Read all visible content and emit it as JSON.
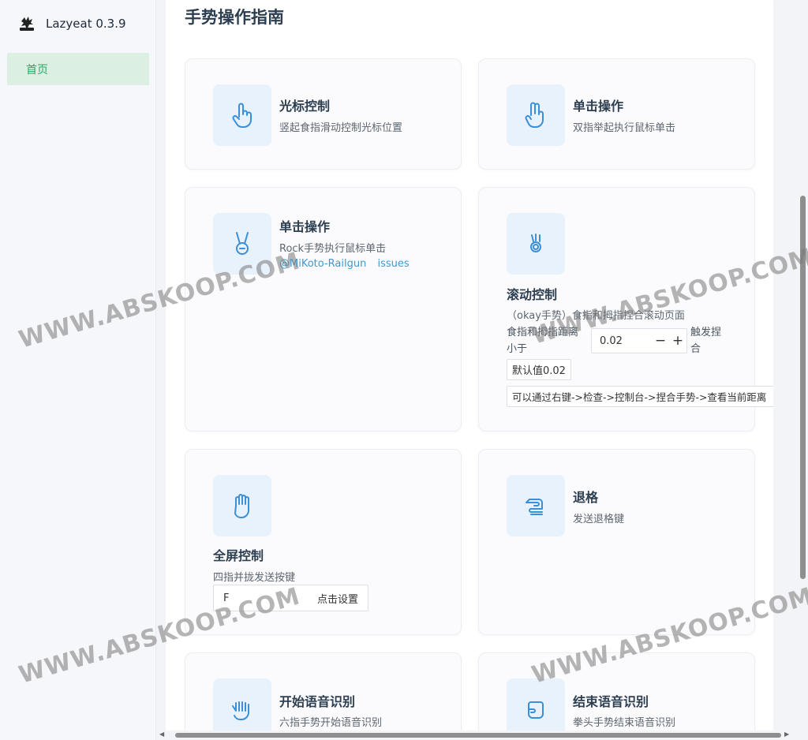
{
  "app": {
    "name": "Lazyeat 0.3.9"
  },
  "sidebar": {
    "items": [
      {
        "label": "首页"
      }
    ]
  },
  "page": {
    "title": "手势操作指南"
  },
  "cards": {
    "cursor": {
      "title": "光标控制",
      "desc": "竖起食指滑动控制光标位置",
      "icon": "pointing-hand-icon"
    },
    "click": {
      "title": "单击操作",
      "desc": "双指举起执行鼠标单击",
      "icon": "two-finger-hand-icon"
    },
    "rock": {
      "title": "单击操作",
      "desc": "Rock手势执行鼠标单击",
      "link_author": "@MiKoto-Railgun",
      "link_issues": "issues",
      "icon": "rock-hand-icon"
    },
    "scroll": {
      "title": "滚动控制",
      "desc": "（okay手势）食指和拇指捏合滚动页面",
      "distance_label_1": "食指和拇指距离",
      "distance_label_2": "小于",
      "threshold_value": "0.02",
      "minus": "−",
      "plus": "+",
      "trigger_label_1": "触发捏",
      "trigger_label_2": "合",
      "default_hint": "默认值0.02",
      "console_hint": "可以通过右键->检查->控制台->捏合手势->查看当前距离",
      "icon": "okay-hand-icon"
    },
    "fullscreen": {
      "title": "全屏控制",
      "desc": "四指并拢发送按键",
      "key_value": "F",
      "set_label": "点击设置",
      "icon": "open-palm-icon"
    },
    "backspace": {
      "title": "退格",
      "desc": "发送退格键",
      "icon": "backspace-hand-icon"
    },
    "voice_start": {
      "title": "开始语音识别",
      "desc": "六指手势开始语音识别",
      "icon": "six-finger-hand-icon"
    },
    "voice_end": {
      "title": "结束语音识别",
      "desc": "拳头手势结束语音识别",
      "icon": "fist-icon"
    }
  },
  "watermark": {
    "text": "WWW.ABSKOOP.COM"
  }
}
